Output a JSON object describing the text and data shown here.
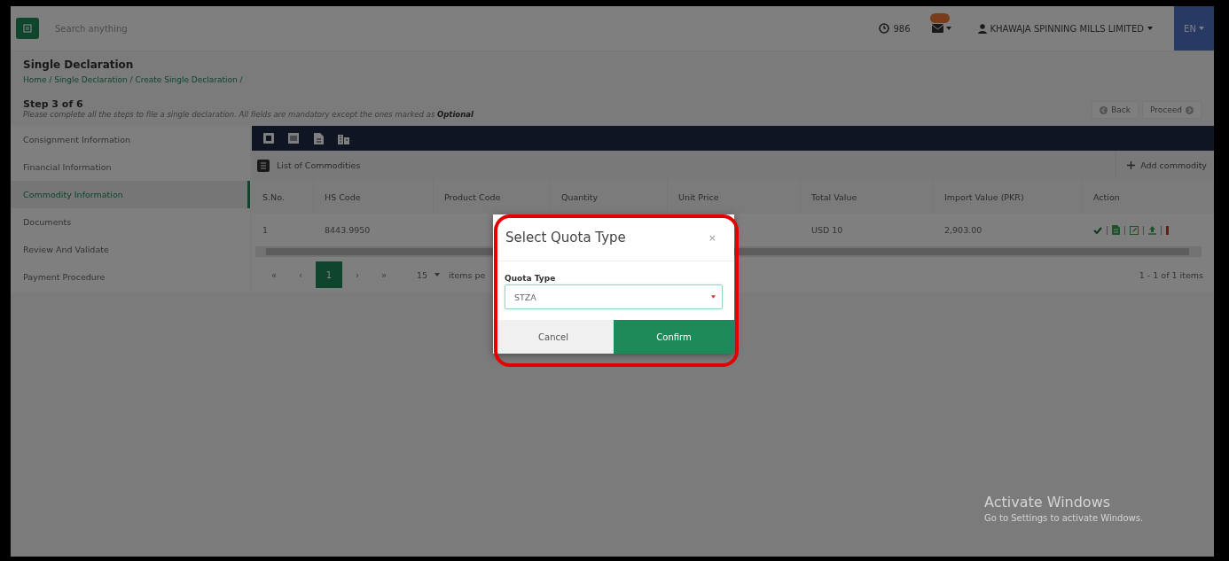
{
  "topbar": {
    "search": {
      "placeholder": "Search anything"
    },
    "counter": "986",
    "company": "KHAWAJA SPINNING MILLS LIMITED",
    "language": "EN"
  },
  "header": {
    "title": "Single Declaration",
    "breadcrumb": "Home / Single Declaration / Create Single Declaration /"
  },
  "step": {
    "title": "Step 3 of 6",
    "description": "Please complete all the steps to file a single declaration. All fields are mandatory except the ones marked as **Optional**",
    "back": "Back",
    "proceed": "Proceed"
  },
  "sidebar": {
    "items": [
      {
        "label": "Consignment Information",
        "selected": false
      },
      {
        "label": "Financial Information",
        "selected": false
      },
      {
        "label": "Commodity Information",
        "selected": true
      },
      {
        "label": "Documents",
        "selected": false
      },
      {
        "label": "Review And Validate",
        "selected": false
      },
      {
        "label": "Payment Procedure",
        "selected": false
      }
    ]
  },
  "commodities": {
    "title": "List of Commodities",
    "add_button": "Add commodity",
    "columns": [
      "S.No.",
      "HS Code",
      "Product Code",
      "Quantity",
      "Unit Price",
      "Total Value",
      "Import Value (PKR)",
      "Action"
    ],
    "rows": [
      {
        "cells": [
          "1",
          "8443.9950",
          null,
          null,
          null,
          "USD 10",
          "2,903.00"
        ]
      }
    ],
    "pagination": {
      "nav": [
        "«",
        "‹",
        "›",
        "»"
      ],
      "pages": [
        {
          "label": "1",
          "selected": true
        }
      ],
      "page_size": "15",
      "page_size_label": "items pe",
      "summary": "1 - 1 of 1 items"
    }
  },
  "dialog": {
    "title": "Select Quota Type",
    "close": "×",
    "field_label": "Quota Type",
    "value": "STZA",
    "highlighted": true,
    "buttons": [
      {
        "label": "Cancel",
        "kind": "secondary"
      },
      {
        "label": "Confirm",
        "kind": "primary"
      }
    ]
  },
  "os_notice": {
    "title": "Activate Windows",
    "subtitle": "Go to Settings to activate Windows."
  }
}
